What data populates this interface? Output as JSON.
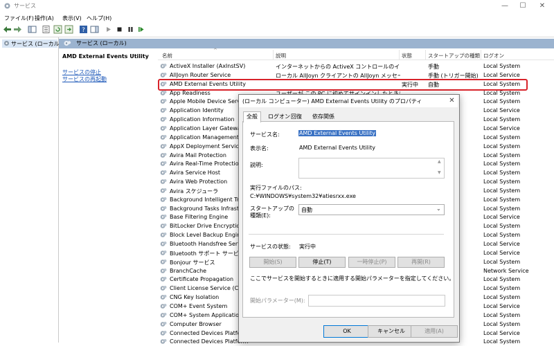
{
  "window": {
    "title": "サービス",
    "min": "—",
    "max": "☐",
    "close": "✕"
  },
  "menu": [
    "ファイル(F)",
    "操作(A)",
    "表示(V)",
    "ヘルプ(H)"
  ],
  "tree": {
    "item": "サービス (ローカル)"
  },
  "pane": {
    "header": "サービス (ローカル)"
  },
  "extended": {
    "title": "AMD External Events Utility",
    "stop": "サービスの停止",
    "restart": "サービスの再起動"
  },
  "columns": {
    "name": "名前",
    "desc": "説明",
    "status": "状態",
    "startup": "スタートアップの種類",
    "logon": "ログオン"
  },
  "rows": [
    {
      "name": "ActiveX Installer (AxInstSV)",
      "desc": "インターネットからの ActiveX コントロールのインストー...",
      "status": "",
      "startup": "手動",
      "logon": "Local System"
    },
    {
      "name": "AllJoyn Router Service",
      "desc": "ローカル AllJoyn クライアントの AllJoyn メッセージをル...",
      "status": "",
      "startup": "手動 (トリガー開始)",
      "logon": "Local Service"
    },
    {
      "name": "AMD External Events Utility",
      "desc": "",
      "status": "実行中",
      "startup": "自動",
      "logon": "Local System"
    },
    {
      "name": "App Readiness",
      "desc": "ユーザーが この PC に初めてサインインしたときや新しい",
      "status": "",
      "startup": "",
      "logon": "Local System"
    },
    {
      "name": "Apple Mobile Device Service",
      "desc": "",
      "status": "",
      "startup": "",
      "logon": "Local System"
    },
    {
      "name": "Application Identity",
      "desc": "",
      "status": "",
      "startup": "",
      "logon": "Local Service"
    },
    {
      "name": "Application Information",
      "desc": "",
      "status": "",
      "startup": "",
      "logon": "Local System"
    },
    {
      "name": "Application Layer Gateway Se",
      "desc": "",
      "status": "",
      "startup": "",
      "logon": "Local Service"
    },
    {
      "name": "Application Management",
      "desc": "",
      "status": "",
      "startup": "",
      "logon": "Local System"
    },
    {
      "name": "AppX Deployment Service (A",
      "desc": "",
      "status": "",
      "startup": "",
      "logon": "Local System"
    },
    {
      "name": "Avira Mail Protection",
      "desc": "",
      "status": "",
      "startup": "",
      "logon": "Local System"
    },
    {
      "name": "Avira Real-Time Protection",
      "desc": "",
      "status": "",
      "startup": "",
      "logon": "Local System"
    },
    {
      "name": "Avira Service Host",
      "desc": "",
      "status": "",
      "startup": "",
      "logon": "Local System"
    },
    {
      "name": "Avira Web Protection",
      "desc": "",
      "status": "",
      "startup": "",
      "logon": "Local System"
    },
    {
      "name": "Avira スケジューラ",
      "desc": "",
      "status": "",
      "startup": "",
      "logon": "Local System"
    },
    {
      "name": "Background Intelligent Trans",
      "desc": "",
      "status": "",
      "startup": "",
      "logon": "Local System"
    },
    {
      "name": "Background Tasks Infrastruct",
      "desc": "",
      "status": "",
      "startup": "",
      "logon": "Local System"
    },
    {
      "name": "Base Filtering Engine",
      "desc": "",
      "status": "",
      "startup": "",
      "logon": "Local Service"
    },
    {
      "name": "BitLocker Drive Encryption S",
      "desc": "",
      "status": "",
      "startup": "",
      "logon": "Local System"
    },
    {
      "name": "Block Level Backup Engine S",
      "desc": "",
      "status": "",
      "startup": "",
      "logon": "Local System"
    },
    {
      "name": "Bluetooth Handsfree Service",
      "desc": "",
      "status": "",
      "startup": "",
      "logon": "Local Service"
    },
    {
      "name": "Bluetooth サポート サービス",
      "desc": "",
      "status": "",
      "startup": "",
      "logon": "Local Service"
    },
    {
      "name": "Bonjour サービス",
      "desc": "",
      "status": "",
      "startup": "",
      "logon": "Local System"
    },
    {
      "name": "BranchCache",
      "desc": "",
      "status": "",
      "startup": "",
      "logon": "Network Service"
    },
    {
      "name": "Certificate Propagation",
      "desc": "",
      "status": "",
      "startup": "",
      "logon": "Local System"
    },
    {
      "name": "Client License Service (ClipS",
      "desc": "",
      "status": "",
      "startup": "",
      "logon": "Local System"
    },
    {
      "name": "CNG Key Isolation",
      "desc": "",
      "status": "",
      "startup": "",
      "logon": "Local System"
    },
    {
      "name": "COM+ Event System",
      "desc": "",
      "status": "",
      "startup": "",
      "logon": "Local Service"
    },
    {
      "name": "COM+ System Application",
      "desc": "",
      "status": "",
      "startup": "",
      "logon": "Local System"
    },
    {
      "name": "Computer Browser",
      "desc": "",
      "status": "",
      "startup": "",
      "logon": "Local System"
    },
    {
      "name": "Connected Devices Platform",
      "desc": "",
      "status": "",
      "startup": "",
      "logon": "Local Service"
    },
    {
      "name": "Connected Devices Platform",
      "desc": "",
      "status": "",
      "startup": "",
      "logon": "Local System"
    }
  ],
  "dialog": {
    "title": "(ローカル コンピューター) AMD External Events Utility のプロパティ",
    "close": "✕",
    "tabs": [
      "全般",
      "ログオン",
      "回復",
      "依存関係"
    ],
    "service_name_label": "サービス名:",
    "service_name": "AMD External Events Utility",
    "display_name_label": "表示名:",
    "display_name": "AMD External Events Utility",
    "description_label": "説明:",
    "exe_path_label": "実行ファイルのパス:",
    "exe_path": "C:¥WINDOWS¥system32¥atiesrxx.exe",
    "startup_label_1": "スタートアップの",
    "startup_label_2": "種類(E):",
    "startup_value": "自動",
    "status_label": "サービスの状態:",
    "status_value": "実行中",
    "buttons": {
      "start": "開始(S)",
      "stop": "停止(T)",
      "pause": "一時停止(P)",
      "resume": "再開(R)"
    },
    "param_hint": "ここでサービスを開始するときに適用する開始パラメーターを指定してください。",
    "param_label": "開始パラメーター(M):",
    "ok": "OK",
    "cancel": "キャンセル",
    "apply": "適用(A)"
  }
}
